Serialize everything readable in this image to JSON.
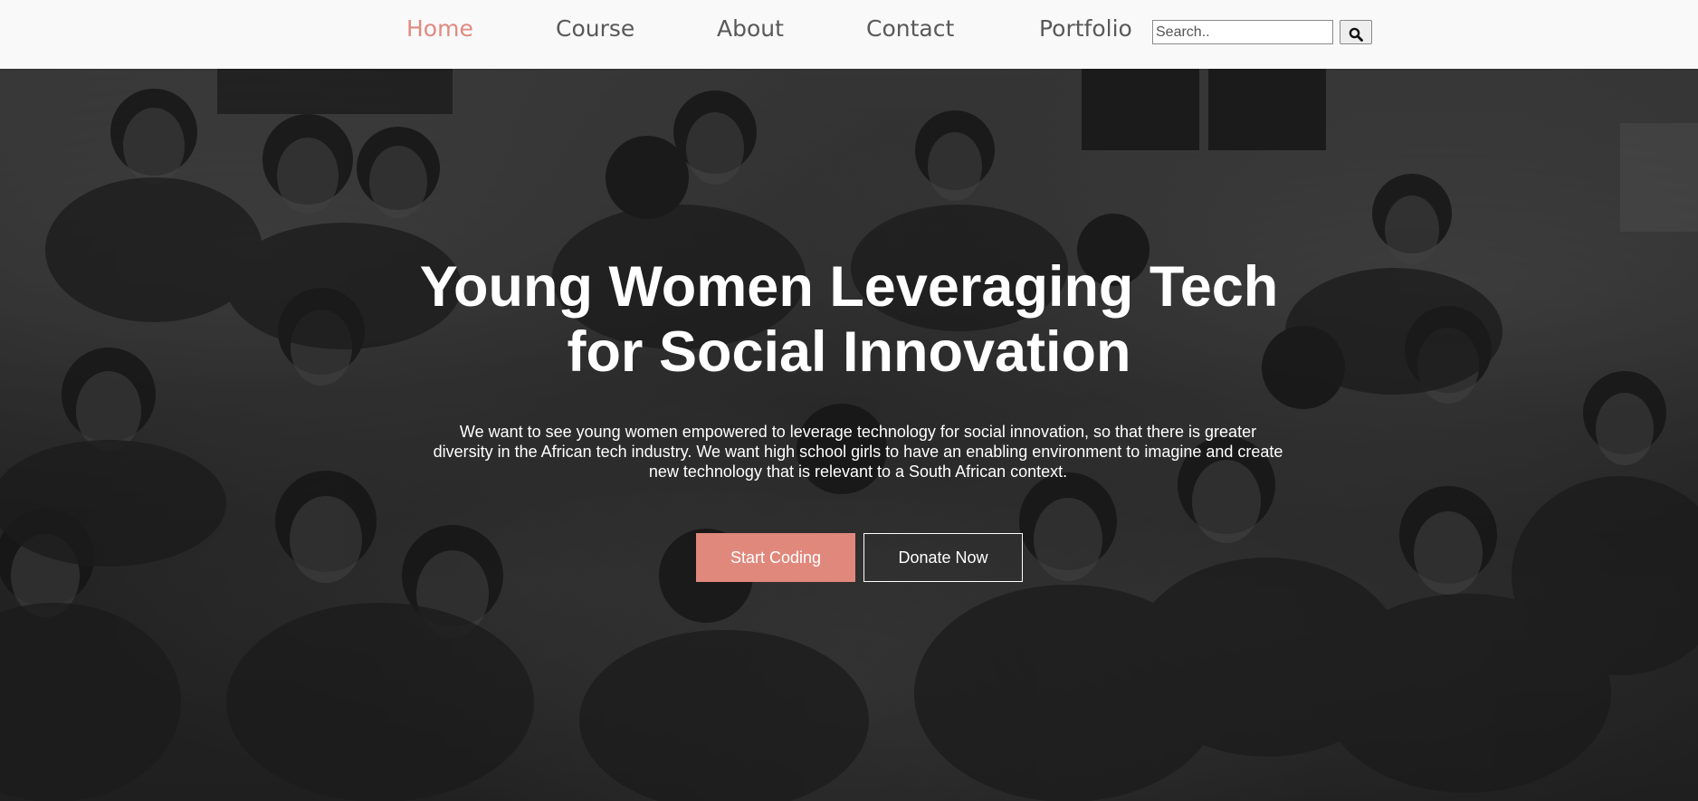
{
  "nav": {
    "items": [
      {
        "label": "Home",
        "active": true
      },
      {
        "label": "Course",
        "active": false
      },
      {
        "label": "About",
        "active": false
      },
      {
        "label": "Contact",
        "active": false
      },
      {
        "label": "Portfolio",
        "active": false
      }
    ],
    "search": {
      "placeholder": "Search..",
      "value": "",
      "button_icon": "search-icon"
    }
  },
  "hero": {
    "title_line1": "Young Women Leveraging Tech",
    "title_line2": "for Social Innovation",
    "description": "We want to see young women empowered to leverage technology for social innovation, so that there is greater diversity in the African tech industry. We want high school girls to have an enabling environment to imagine and create new technology that is relevant to a South African context.",
    "primary_button": "Start Coding",
    "secondary_button": "Donate Now",
    "background_image": "group-photo-of-young-people-grayscale"
  },
  "colors": {
    "accent": "#e0887c",
    "nav_text": "#595959",
    "nav_background": "#f9f9f9",
    "hero_text": "#ffffff"
  }
}
